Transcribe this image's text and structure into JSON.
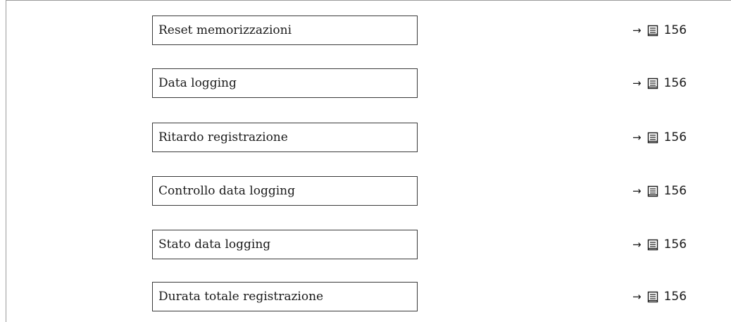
{
  "items": [
    {
      "label": "Reset memorizzazioni",
      "page": "156",
      "arrow": "→"
    },
    {
      "label": "Data logging",
      "page": "156",
      "arrow": "→"
    },
    {
      "label": "Ritardo registrazione",
      "page": "156",
      "arrow": "→"
    },
    {
      "label": "Controllo data logging",
      "page": "156",
      "arrow": "→"
    },
    {
      "label": "Stato data logging",
      "page": "156",
      "arrow": "→"
    },
    {
      "label": "Durata totale registrazione",
      "page": "156",
      "arrow": "→"
    }
  ]
}
